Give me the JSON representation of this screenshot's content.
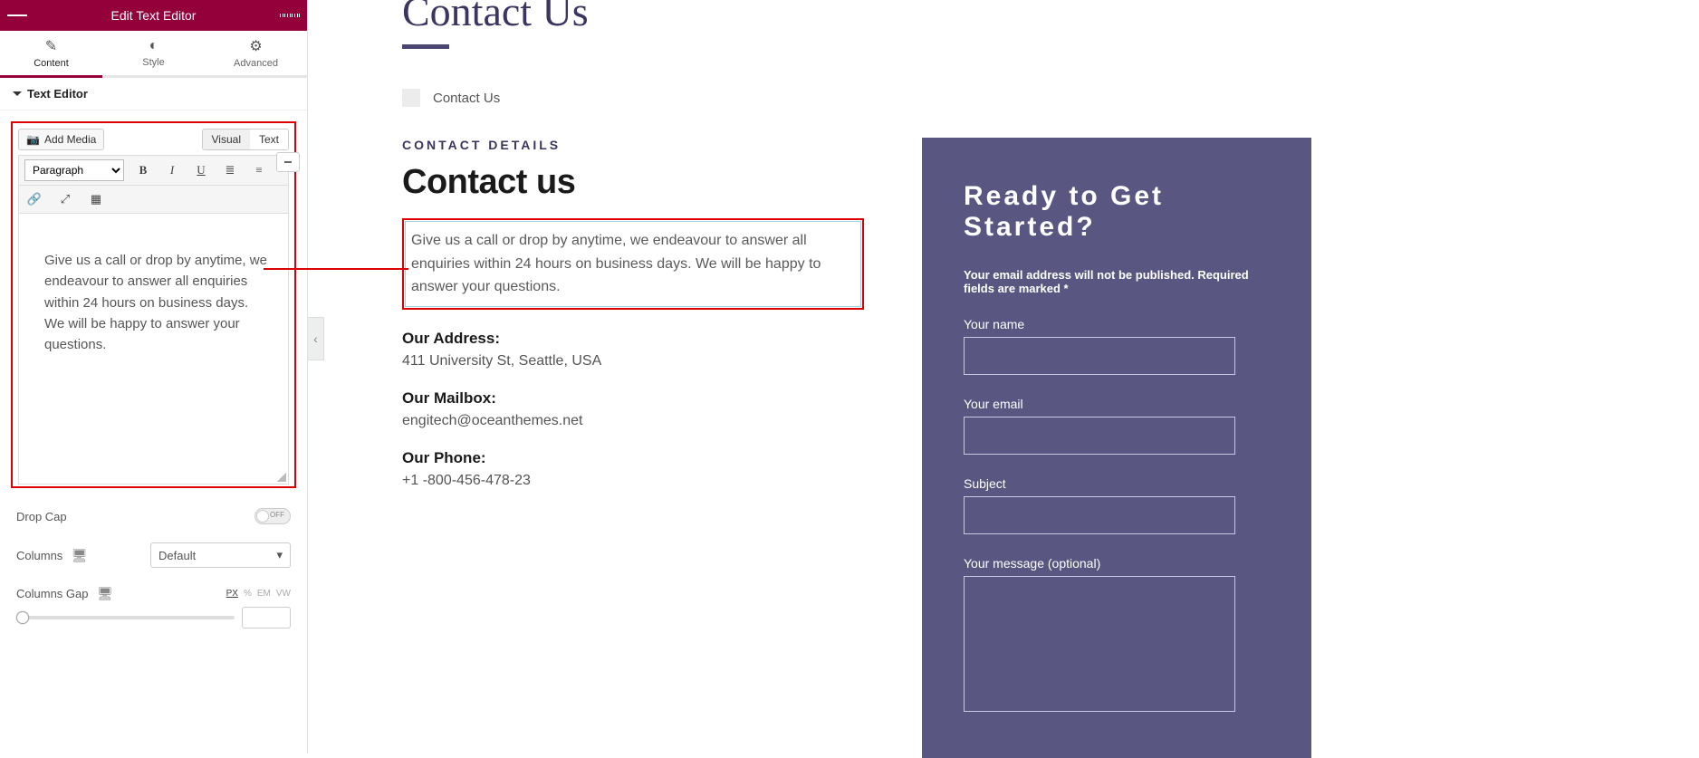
{
  "sidebar": {
    "header_title": "Edit Text Editor",
    "tabs": {
      "content": "Content",
      "style": "Style",
      "advanced": "Advanced"
    },
    "section_title": "Text Editor",
    "add_media_label": "Add Media",
    "visual_tab": "Visual",
    "text_tab": "Text",
    "format_select": "Paragraph",
    "editor_text": "Give us a call or drop by anytime, we endeavour to answer all enquiries within 24 hours on business days. We will be happy to answer your questions.",
    "drop_cap_label": "Drop Cap",
    "drop_cap_state": "OFF",
    "columns_label": "Columns",
    "columns_value": "Default",
    "columns_gap_label": "Columns Gap",
    "units": {
      "px": "PX",
      "pct": "%",
      "em": "EM",
      "vw": "VW"
    }
  },
  "preview": {
    "page_title": "Contact Us",
    "breadcrumb": "Contact Us",
    "section_label": "CONTACT DETAILS",
    "heading": "Contact us",
    "paragraph": "Give us a call or drop by anytime, we endeavour to answer all enquiries within 24 hours on business days. We will be happy to answer your questions.",
    "address_label": "Our Address:",
    "address_value": "411 University St, Seattle, USA",
    "mailbox_label": "Our Mailbox:",
    "mailbox_value": "engitech@oceanthemes.net",
    "phone_label": "Our Phone:",
    "phone_value": "+1 -800-456-478-23",
    "form_heading": "Ready to Get Started?",
    "form_note": "Your email address will not be published. Required fields are marked *",
    "field_name": "Your name",
    "field_email": "Your email",
    "field_subject": "Subject",
    "field_message": "Your message (optional)"
  }
}
